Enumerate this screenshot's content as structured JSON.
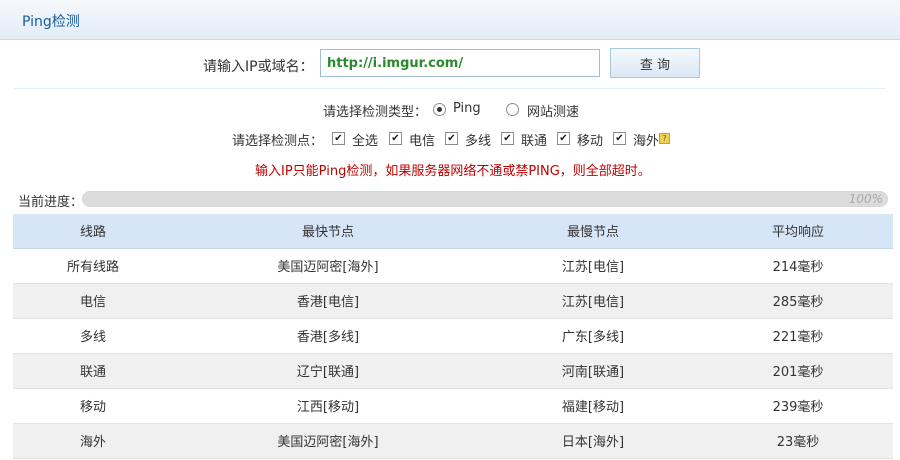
{
  "header": {
    "title": "Ping检测"
  },
  "form": {
    "input_label": "请输入IP或域名：",
    "url_value": "http://i.imgur.com/",
    "query_button": "查 询",
    "type_label": "请选择检测类型：",
    "type_options": [
      {
        "label": "Ping",
        "checked": true
      },
      {
        "label": "网站测速",
        "checked": false
      }
    ],
    "nodes_label": "请选择检测点：",
    "nodes": [
      {
        "label": "全选",
        "checked": true
      },
      {
        "label": "电信",
        "checked": true
      },
      {
        "label": "多线",
        "checked": true
      },
      {
        "label": "联通",
        "checked": true
      },
      {
        "label": "移动",
        "checked": true
      },
      {
        "label": "海外",
        "checked": true
      }
    ],
    "notice": "输入IP只能Ping检测，如果服务器网络不通或禁PING，则全部超时。"
  },
  "progress": {
    "label": "当前进度：",
    "value": 100,
    "text": "100%"
  },
  "table": {
    "headers": [
      "线路",
      "最快节点",
      "最慢节点",
      "平均响应"
    ],
    "rows": [
      [
        "所有线路",
        "美国迈阿密[海外]",
        "江苏[电信]",
        "214毫秒"
      ],
      [
        "电信",
        "香港[电信]",
        "江苏[电信]",
        "285毫秒"
      ],
      [
        "多线",
        "香港[多线]",
        "广东[多线]",
        "221毫秒"
      ],
      [
        "联通",
        "辽宁[联通]",
        "河南[联通]",
        "201毫秒"
      ],
      [
        "移动",
        "江西[移动]",
        "福建[移动]",
        "239毫秒"
      ],
      [
        "海外",
        "美国迈阿密[海外]",
        "日本[海外]",
        "23毫秒"
      ]
    ]
  }
}
